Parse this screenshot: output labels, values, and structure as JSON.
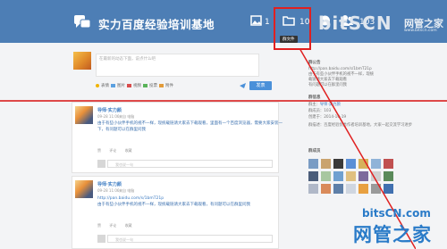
{
  "header": {
    "title": "实力百度经验培训基地",
    "stats": [
      {
        "icon": "image-icon",
        "count": "1"
      },
      {
        "icon": "folder-icon",
        "count": "10"
      },
      {
        "icon": "chat-icon",
        "count": ""
      },
      {
        "icon": "users-icon",
        "count": "103"
      }
    ],
    "tooltip": "群文件"
  },
  "watermark_top": {
    "sign": "bitSCN",
    "cn": "网管之家",
    "url": "www.bitscn.com"
  },
  "composer": {
    "placeholder": "在最新的动态下面，说点什么吧",
    "tools": [
      "表情",
      "图片",
      "视频",
      "投票",
      "附件"
    ],
    "publish_label": "发表"
  },
  "posts": [
    {
      "name": "导师·实力颜",
      "date": "09-28 11:06",
      "source": "来自 电脑",
      "text": "由于有些小伙伴手机的视不一样，现统载链请大家去下载观看，里面有一个百度浏览器，需要大家安装一下，有问题可以在群里问我",
      "actions": [
        "赞",
        "评论",
        "收藏"
      ],
      "comment_placeholder": "我也说一句"
    },
    {
      "name": "导师·实力颜",
      "date": "09-28 11:06",
      "source": "来自 电脑",
      "link": "http://pan.baidu.com/s/1bmT21p",
      "text": "由于有些小伙伴手机的视不一样，现统载链请大家去下载观看，有问题可以在群里问我",
      "actions": [
        "赞",
        "评论",
        "收藏"
      ],
      "comment_placeholder": "我也说一句"
    }
  ],
  "sidebar": {
    "notice_title": "群公告",
    "notice_lines": [
      "http://pan.baidu.com/s/1bmT21p",
      "由于有些小伙伴手机的视不一样，现统",
      "载链请大家去下载观看"
    ],
    "notice_more": "有问题可以在群里问我",
    "info_title": "群信息",
    "info_lines": [
      {
        "label": "群主：",
        "value": "导师·实力颜"
      },
      {
        "label": "群成员：",
        "value": "103"
      },
      {
        "label": "创建于：",
        "value": "2014-10-19"
      }
    ],
    "info_desc": "群描述：百度经验优秀作者培训基地，大家一起交流学习进步",
    "members_title": "群成员"
  },
  "watermark_bottom": {
    "bits": "bitsCN.com",
    "cn": "网管之家"
  },
  "colors": {
    "header": "#4d7eb5",
    "accent": "#3b7bc2",
    "highlight": "#e02020",
    "publish": "#4a90d9"
  }
}
